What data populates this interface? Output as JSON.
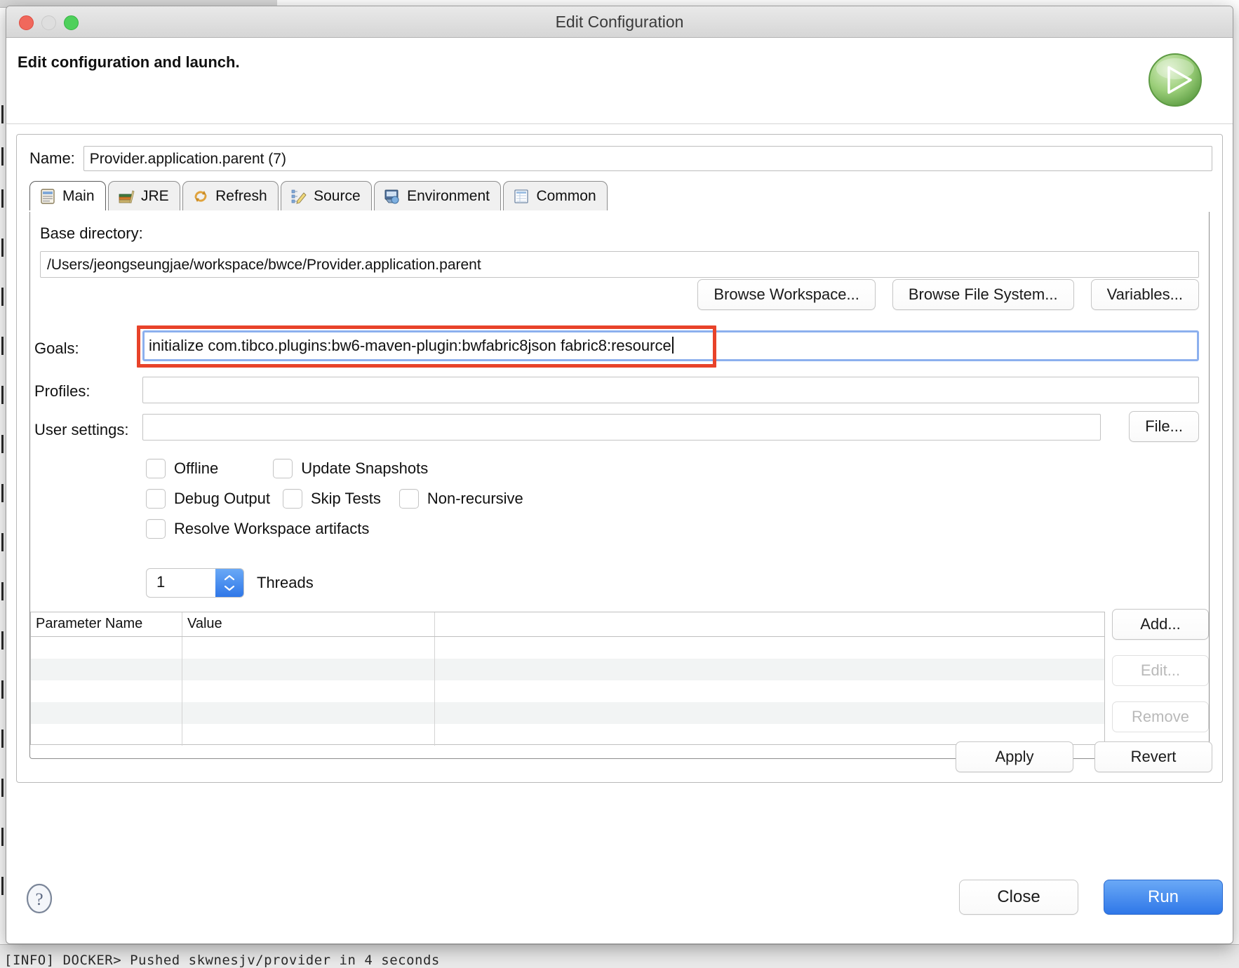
{
  "window": {
    "title": "Edit Configuration",
    "header_title": "Edit configuration and launch.",
    "run_icon": "run-play-icon"
  },
  "name": {
    "label": "Name:",
    "value": "Provider.application.parent (7)"
  },
  "tabs": [
    {
      "label": "Main",
      "icon": "main-document-icon",
      "active": true
    },
    {
      "label": "JRE",
      "icon": "jre-books-icon",
      "active": false
    },
    {
      "label": "Refresh",
      "icon": "refresh-arrows-icon",
      "active": false
    },
    {
      "label": "Source",
      "icon": "source-pencil-icon",
      "active": false
    },
    {
      "label": "Environment",
      "icon": "environment-icon",
      "active": false
    },
    {
      "label": "Common",
      "icon": "common-table-icon",
      "active": false
    }
  ],
  "main": {
    "base_directory": {
      "label": "Base directory:",
      "value": "/Users/jeongseungjae/workspace/bwce/Provider.application.parent"
    },
    "browse_buttons": [
      "Browse Workspace...",
      "Browse File System...",
      "Variables..."
    ],
    "goals": {
      "label": "Goals:",
      "value": "initialize com.tibco.plugins:bw6-maven-plugin:bwfabric8json fabric8:resource",
      "highlighted": true,
      "highlight_color": "#e8432a",
      "focus_color": "#8cb0ee"
    },
    "profiles": {
      "label": "Profiles:",
      "value": ""
    },
    "user_settings": {
      "label": "User settings:",
      "value": "",
      "button": "File..."
    },
    "checkboxes": [
      {
        "label": "Offline",
        "checked": false
      },
      {
        "label": "Update Snapshots",
        "checked": false
      },
      {
        "label": "Debug Output",
        "checked": false
      },
      {
        "label": "Skip Tests",
        "checked": false
      },
      {
        "label": "Non-recursive",
        "checked": false
      },
      {
        "label": "Resolve Workspace artifacts",
        "checked": false
      }
    ],
    "threads": {
      "value": "1",
      "label": "Threads"
    },
    "parameters_table": {
      "columns": [
        "Parameter Name",
        "Value",
        ""
      ],
      "rows": [
        [
          "",
          "",
          ""
        ],
        [
          "",
          "",
          ""
        ],
        [
          "",
          "",
          ""
        ],
        [
          "",
          "",
          ""
        ],
        [
          "",
          "",
          ""
        ]
      ]
    },
    "table_buttons": [
      {
        "label": "Add...",
        "enabled": true
      },
      {
        "label": "Edit...",
        "enabled": false
      },
      {
        "label": "Remove",
        "enabled": false
      }
    ],
    "apply_revert": [
      {
        "label": "Apply",
        "enabled": true
      },
      {
        "label": "Revert",
        "enabled": true
      }
    ]
  },
  "footer": {
    "help_icon": "help-question-icon",
    "buttons": [
      {
        "label": "Close",
        "primary": false
      },
      {
        "label": "Run",
        "primary": true
      }
    ]
  },
  "background": {
    "console_line": "[INFO] DOCKER> Pushed skwnesjv/provider in 4 seconds"
  }
}
